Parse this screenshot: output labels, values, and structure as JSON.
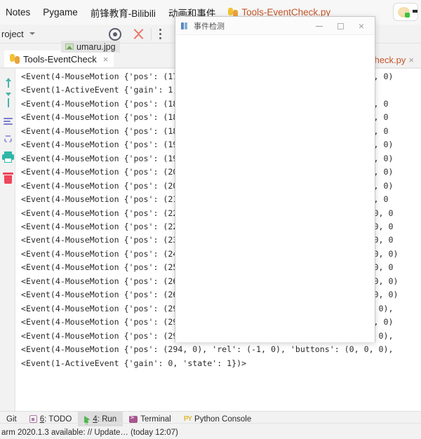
{
  "browser_tabs": [
    {
      "label": "Notes",
      "icon": null,
      "active": false
    },
    {
      "label": "Pygame",
      "icon": null,
      "active": false
    },
    {
      "label": "前锋教育-Bilibili",
      "icon": null,
      "active": false
    },
    {
      "label": "动画和事件",
      "icon": null,
      "active": false
    },
    {
      "label": "Tools-EventCheck.py",
      "icon": "python-icon",
      "active": true
    }
  ],
  "top_right_chip": {
    "name": "thumbnail-chip",
    "status_dot_color": "#3ec13e"
  },
  "ide_toolbar": {
    "project_label": "roject",
    "icons": [
      "target-icon",
      "collapse-all-icon",
      "more-options-icon"
    ]
  },
  "editor": {
    "umaru_tab_label": "umaru.jpg",
    "tools_tab_label": "Tools-EventCheck",
    "tools_tab_close": "×",
    "right_tab_label": "Check.py",
    "right_tab_close": "×"
  },
  "left_toolbar": {
    "items": [
      {
        "name": "scroll-up-icon",
        "title": "Up"
      },
      {
        "name": "scroll-down-icon",
        "title": "Down"
      },
      {
        "name": "soft-wrap-icon",
        "title": "Soft-Wrap"
      },
      {
        "name": "scroll-to-end-icon",
        "title": "Scroll to End"
      },
      {
        "name": "print-icon",
        "title": "Print"
      },
      {
        "name": "delete-icon",
        "title": "Clear All"
      }
    ]
  },
  "console": {
    "lines": [
      "<Event(4-MouseMotion {'pos': (178, 297), 'rel': (0, 1), 'buttons': (0, 0, 0)",
      "<Event(1-ActiveEvent {'gain': 1, 'state': 1})>          : (0, 0,",
      "<Event(4-MouseMotion {'pos': (180, 300), 'rel': (2, 3), 'buttons': (0, 0, 0",
      "<Event(4-MouseMotion {'pos': (183, 303), 'rel': (3, 3), 'buttons': (0, 0, 0",
      "<Event(4-MouseMotion {'pos': (187, 305), 'rel': (4, 2), 'buttons': (0, 0, 0",
      "<Event(4-MouseMotion {'pos': (191, 307), 'rel': (4, 2), 'buttons': (0, 0, 0)",
      "<Event(4-MouseMotion {'pos': (196, 309), 'rel': (5, 2), 'buttons': (0, 0, 0)",
      "<Event(4-MouseMotion {'pos': (201, 310), 'rel': (5, 1), 'buttons': (0, 0, 0)",
      "<Event(4-MouseMotion {'pos': (207, 311), 'rel': (6, 1), 'buttons': (0, 0, 0)",
      "<Event(4-MouseMotion {'pos': (213, 311), 'rel': (6, 0), 'buttons': (0, 0, 0",
      "<Event(4-MouseMotion {'pos': (220, 310), 'rel': (7, -1), 'buttons': (0, 0, 0",
      "<Event(4-MouseMotion {'pos': (228, 308), 'rel': (8, -2), 'buttons': (0, 0, 0",
      "<Event(4-MouseMotion {'pos': (236, 305), 'rel': (8, -3), 'buttons': (0, 0, 0",
      "<Event(4-MouseMotion {'pos': (245, 301), 'rel': (9, -4), 'buttons': (0, 0, 0)",
      "<Event(4-MouseMotion {'pos': (253, 296), 'rel': (8, -5), 'buttons': (0, 0, 0",
      "<Event(4-MouseMotion {'pos': (261, 290), 'rel': (8, -6), 'buttons': (0, 0, 0)",
      "<Event(4-MouseMotion {'pos': (268, 283), 'rel': (7, -7), 'buttons': (0, 0, 0)",
      "<Event(4-MouseMotion {'pos': (296, 6), 'rel': (0, -2), 'buttons': (0, 0, 0),",
      "<Event(4-MouseMotion {'pos': (295, 4), 'rel': (-1, -2), 'buttons': (0, 0, 0)",
      "<Event(4-MouseMotion {'pos': (295, 0), 'rel': (0, -4), 'buttons': (0, 0, 0),",
      "<Event(4-MouseMotion {'pos': (294, 0), 'rel': (-1, 0), 'buttons': (0, 0, 0),",
      "<Event(1-ActiveEvent {'gain': 0, 'state': 1})>"
    ]
  },
  "pygame_window": {
    "title": "事件检测",
    "icon": "pygame-icon",
    "minimize": "—",
    "maximize": "□",
    "close": "×"
  },
  "bottom_tool_windows": [
    {
      "label": "Git",
      "mnemonic": "",
      "icon": null,
      "active": false
    },
    {
      "label": ": TODO",
      "mnemonic": "6",
      "icon": "todo-icon",
      "active": false
    },
    {
      "label": ": Run",
      "mnemonic": "4",
      "icon": "run-icon",
      "active": true
    },
    {
      "label": "Terminal",
      "mnemonic": "",
      "icon": "terminal-icon",
      "active": false
    },
    {
      "label": "Python Console",
      "mnemonic": "",
      "icon": "python-console-icon",
      "active": false
    }
  ],
  "status_bar": {
    "message": "arm 2020.1.3 available: // Update… (today 12:07)"
  },
  "colors": {
    "accent_blue": "#4682d6",
    "python_orange": "#c4552a",
    "run_green": "#35c135",
    "delete_red": "#f0455a",
    "print_teal": "#2fb6a8"
  }
}
